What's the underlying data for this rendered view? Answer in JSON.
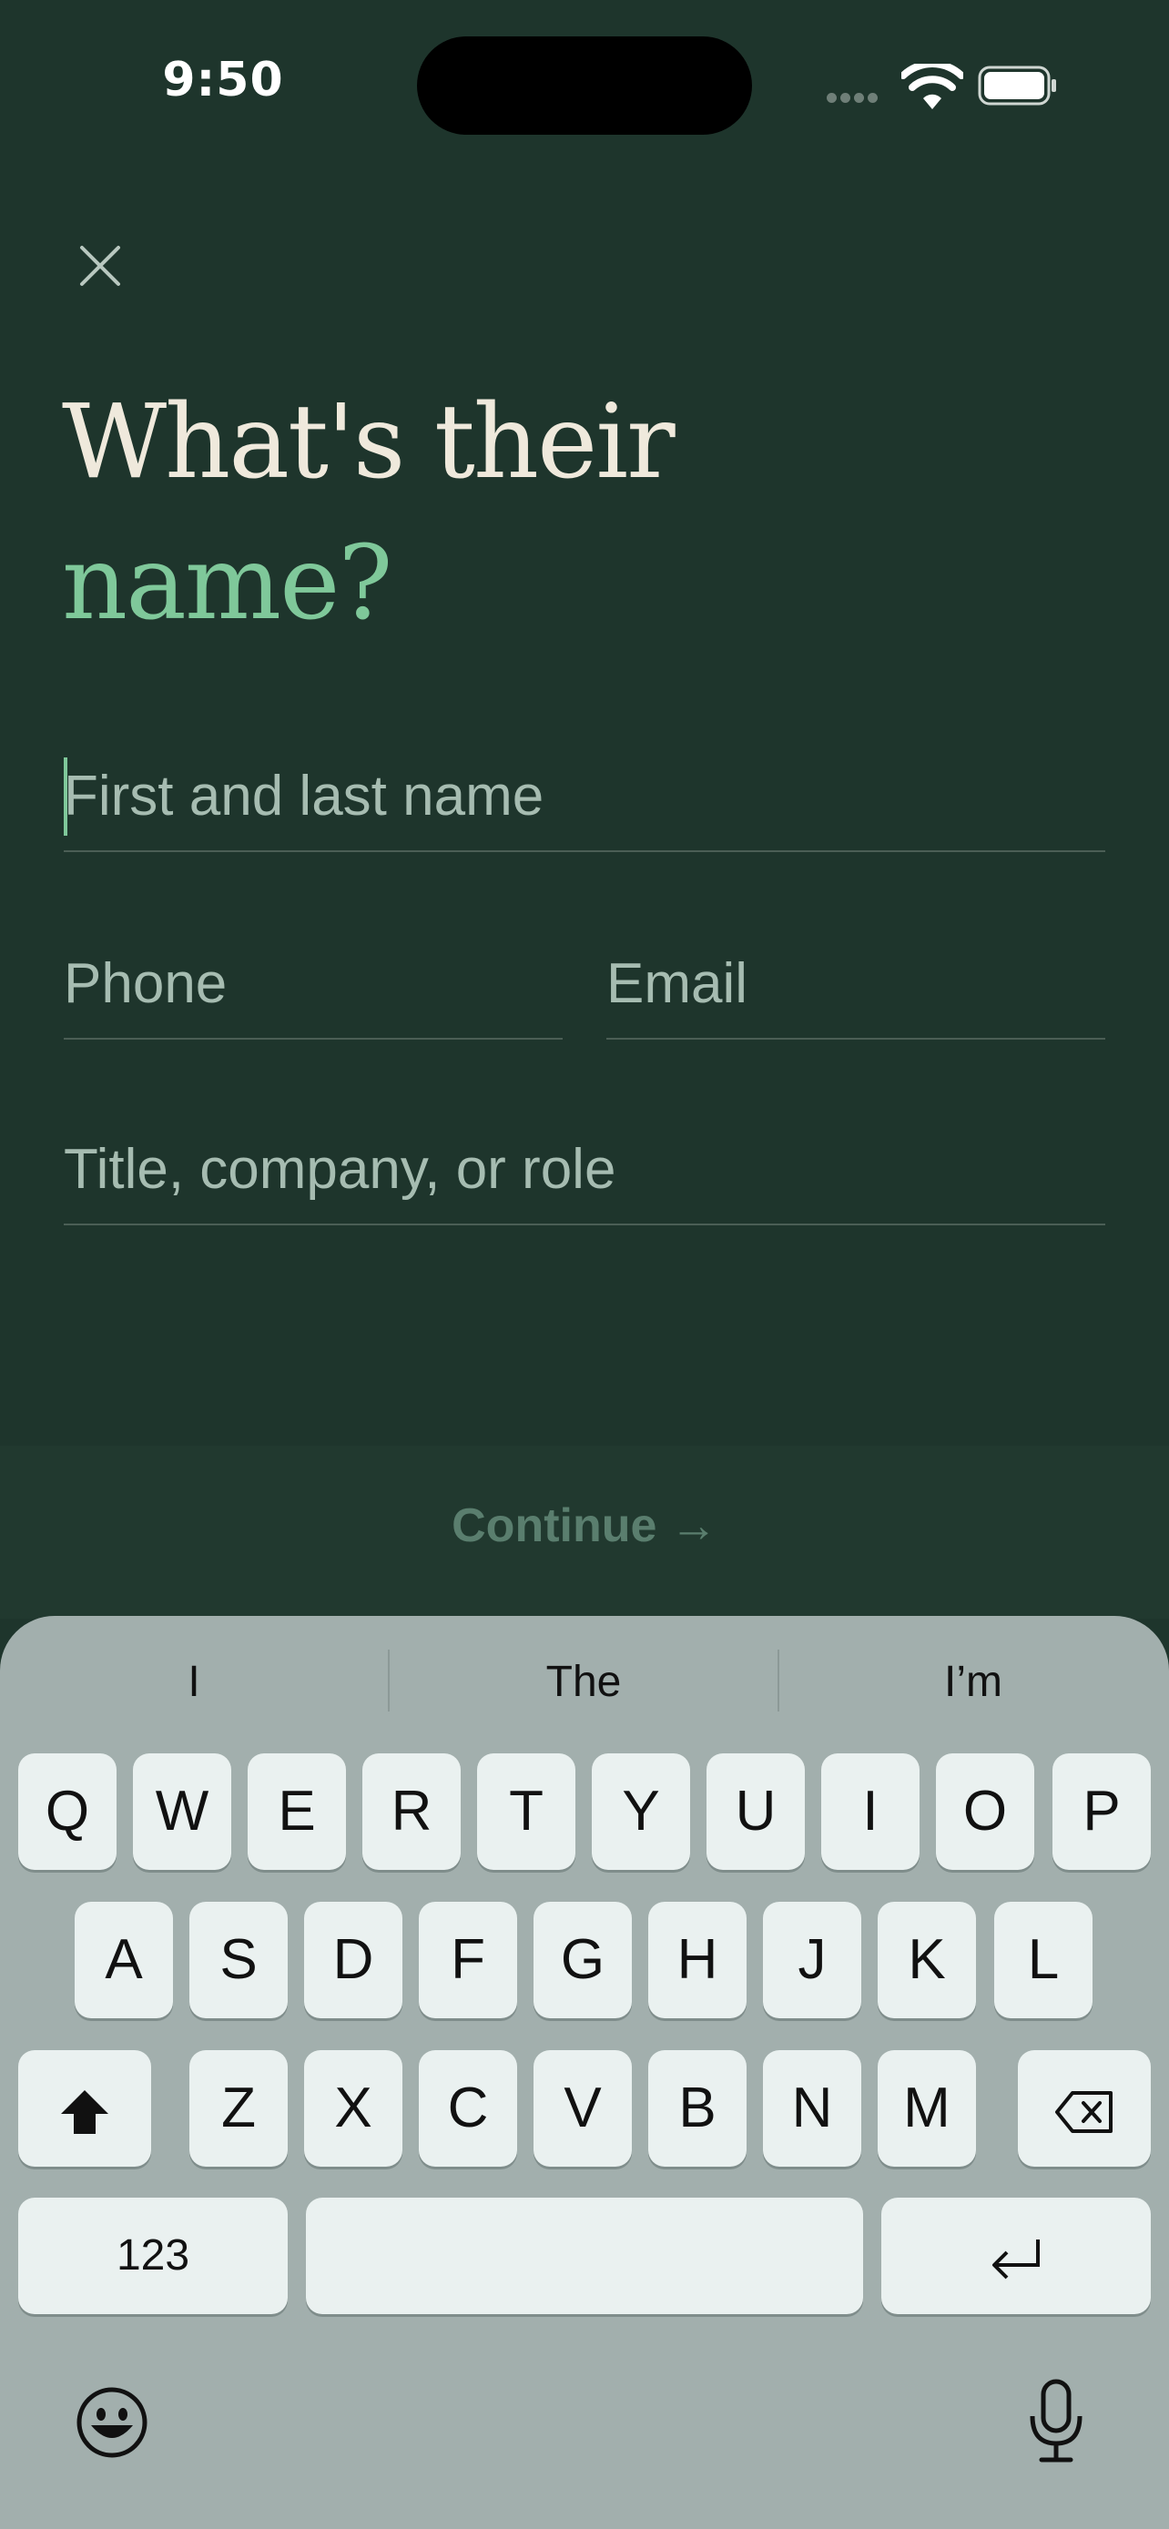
{
  "status": {
    "time": "9:50"
  },
  "heading": {
    "line1": "What's their",
    "line2": "name?"
  },
  "fields": {
    "name_placeholder": "First and last name",
    "phone_placeholder": "Phone",
    "email_placeholder": "Email",
    "title_placeholder": "Title, company, or role"
  },
  "continue_label": "Continue →",
  "keyboard": {
    "suggestions": [
      "I",
      "The",
      "I’m"
    ],
    "row1": [
      "Q",
      "W",
      "E",
      "R",
      "T",
      "Y",
      "U",
      "I",
      "O",
      "P"
    ],
    "row2": [
      "A",
      "S",
      "D",
      "F",
      "G",
      "H",
      "J",
      "K",
      "L"
    ],
    "row3": [
      "Z",
      "X",
      "C",
      "V",
      "B",
      "N",
      "M"
    ],
    "numbers_label": "123"
  },
  "colors": {
    "background": "#1e352c",
    "accent": "#7fc89a",
    "heading": "#efe9dc"
  }
}
